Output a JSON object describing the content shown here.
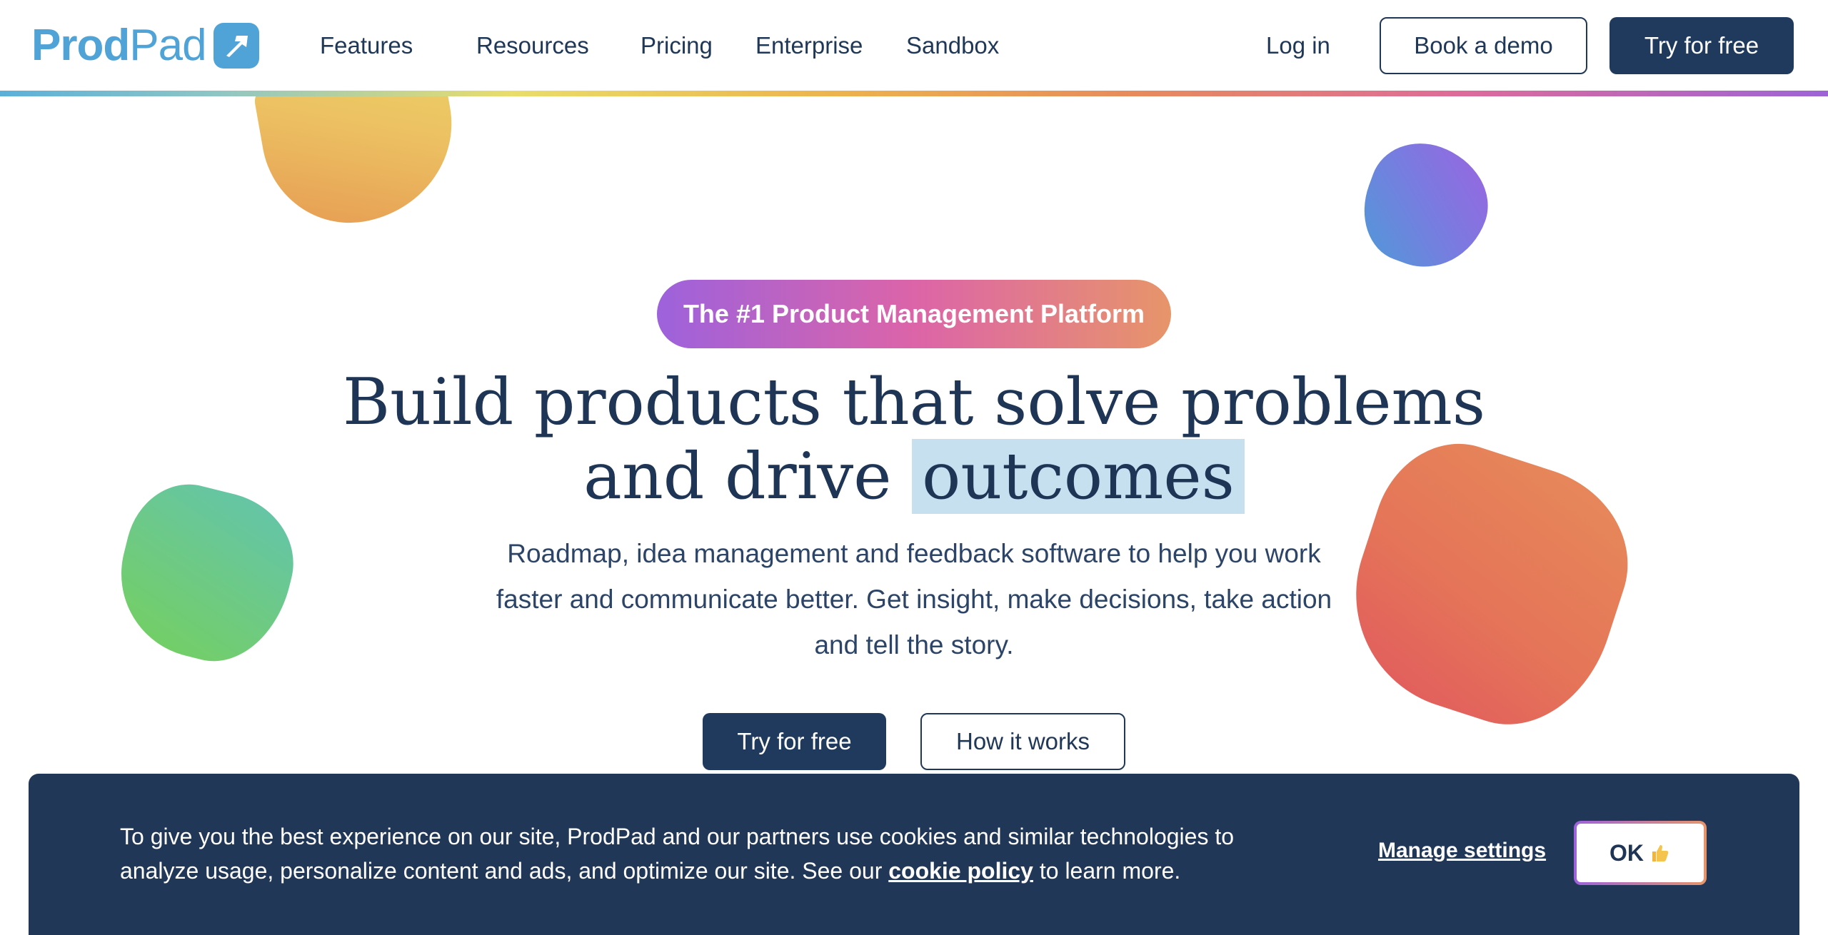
{
  "header": {
    "logo_text_prod": "Prod",
    "logo_text_pad": "Pad",
    "nav": [
      "Features",
      "Resources",
      "Pricing",
      "Enterprise",
      "Sandbox"
    ],
    "login": "Log in",
    "book_demo": "Book a demo",
    "try_free": "Try for free"
  },
  "hero": {
    "badge": "The #1 Product Management Platform",
    "title_line1": "Build products that solve problems",
    "title_line2_pre": "and drive ",
    "title_highlight": "outcomes",
    "subtitle": "Roadmap, idea management and feedback software to help you work faster and communicate better. Get insight, make decisions, take action and tell the story.",
    "try_free": "Try for free",
    "how_it_works": "How it works"
  },
  "cookie": {
    "text_pre": "To give you the best experience on our site, ProdPad and our partners use cookies and similar technologies to analyze usage, personalize content and ads, and optimize our site. See our ",
    "policy_link": "cookie policy",
    "text_post": " to learn more.",
    "manage": "Manage settings",
    "ok": "OK"
  },
  "colors": {
    "navy": "#1f3a5c",
    "brand_blue": "#4fa3d6",
    "highlight": "#c6e0f0"
  }
}
